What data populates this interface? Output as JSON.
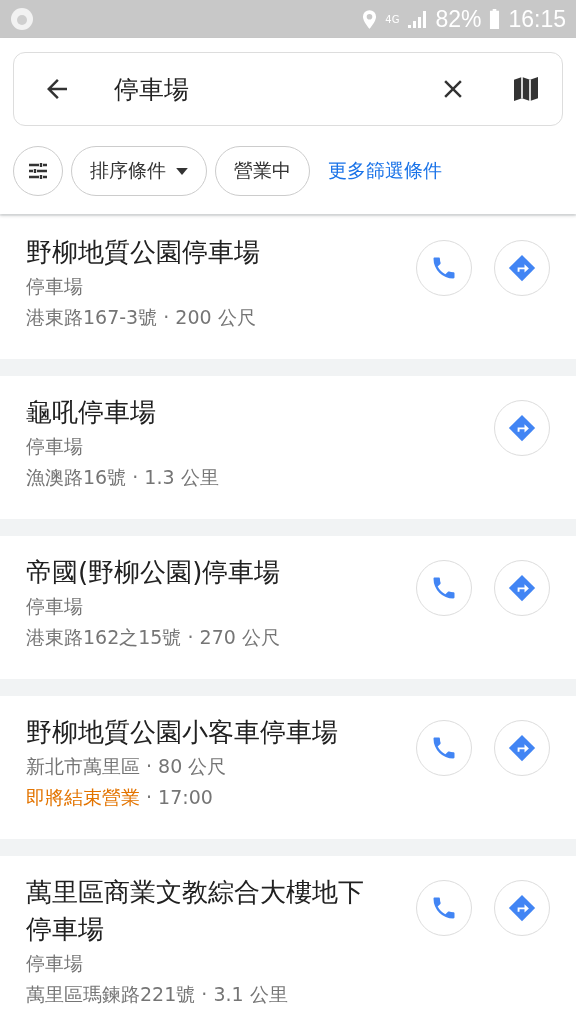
{
  "status_bar": {
    "network": "4G",
    "battery": "82%",
    "time": "16:15"
  },
  "search": {
    "value": "停車場"
  },
  "filters": [
    {
      "kind": "icon"
    },
    {
      "kind": "dropdown",
      "label": "排序條件"
    },
    {
      "kind": "chip",
      "label": "營業中"
    },
    {
      "kind": "link",
      "label": "更多篩選條件"
    }
  ],
  "results": [
    {
      "name": "野柳地質公園停車場",
      "has_call": true,
      "lines": [
        [
          {
            "kind": "plain",
            "text": "停車場"
          }
        ],
        [
          {
            "kind": "plain",
            "text": "港東路167-3號 · 200 公尺"
          }
        ]
      ]
    },
    {
      "name": "龜吼停車場",
      "has_call": false,
      "lines": [
        [
          {
            "kind": "plain",
            "text": "停車場"
          }
        ],
        [
          {
            "kind": "plain",
            "text": "漁澳路16號 · 1.3 公里"
          }
        ]
      ]
    },
    {
      "name": "帝國(野柳公園)停車場",
      "has_call": true,
      "lines": [
        [
          {
            "kind": "plain",
            "text": "停車場"
          }
        ],
        [
          {
            "kind": "plain",
            "text": "港東路162之15號 · 270 公尺"
          }
        ]
      ]
    },
    {
      "name": "野柳地質公園小客車停車場",
      "has_call": true,
      "lines": [
        [
          {
            "kind": "plain",
            "text": "新北市萬里區 · 80 公尺"
          }
        ],
        [
          {
            "kind": "warning",
            "text": "即將結束營業"
          },
          {
            "kind": "plain",
            "text": " · 17:00"
          }
        ]
      ]
    },
    {
      "name": "萬里區商業文教綜合大樓地下停車場",
      "has_call": true,
      "lines": [
        [
          {
            "kind": "plain",
            "text": "停車場"
          }
        ],
        [
          {
            "kind": "plain",
            "text": "萬里區瑪鍊路221號 · 3.1 公里"
          }
        ]
      ]
    }
  ]
}
